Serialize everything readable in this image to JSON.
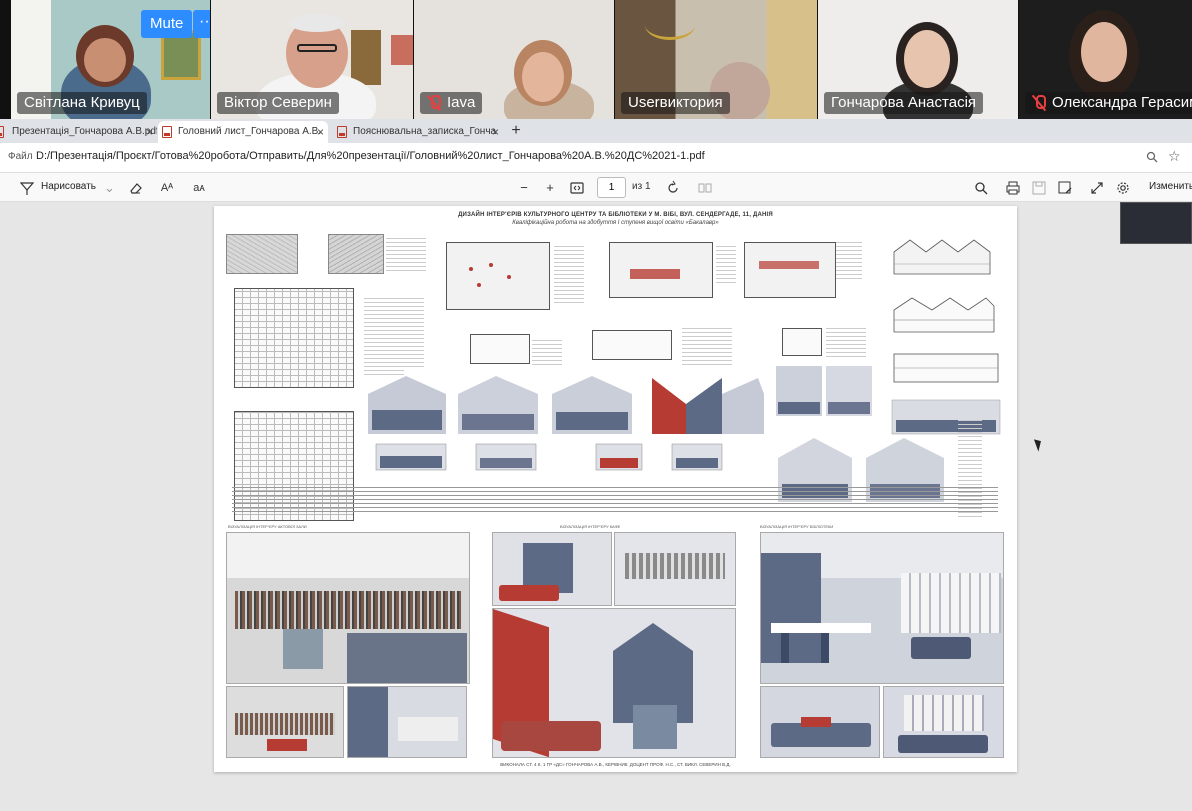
{
  "meeting": {
    "mute_label": "Mute",
    "more_label": "···",
    "participants": [
      {
        "name": "Світлана Кривуц",
        "muted": false
      },
      {
        "name": "Віктор Северин",
        "muted": false,
        "active_speaker": true
      },
      {
        "name": "Iava",
        "muted": true
      },
      {
        "name": "Userвиктория",
        "muted": false
      },
      {
        "name": "Гончарова Анастасія",
        "muted": false
      },
      {
        "name": "Олександра Герасим",
        "muted": true
      }
    ]
  },
  "browser": {
    "tabs": [
      {
        "label": "Презентація_Гончарова А.В.pdf",
        "active": false
      },
      {
        "label": "Головний лист_Гончарова А.В.",
        "active": true
      },
      {
        "label": "Пояснювальна_записка_Гонча",
        "active": false
      }
    ],
    "new_tab_label": "+",
    "close_label": "×",
    "file_label": "Файл",
    "url": "D:/Презентація/Проєкт/Готова%20робота/Отправить/Для%20презентації/Головний%20лист_Гончарова%20А.В.%20ДС%2021-1.pdf"
  },
  "pdf_toolbar": {
    "draw_label": "Нарисовать",
    "text_size_label": "Aᴬ",
    "read_label": "aᴀ",
    "zoom_out": "−",
    "zoom_in": "+",
    "page_current": "1",
    "page_total": "из 1",
    "edit_label": "Изменить"
  },
  "poster": {
    "title": "ДИЗАЙН ІНТЕР'ЄРІВ КУЛЬТУРНОГО ЦЕНТРУ ТА БІБЛІОТЕКИ У М. ВІБІ, ВУЛ. СЕНДЕРГАДЕ, 11, ДАНІЯ",
    "subtitle": "Кваліфікаційна робота на здобуття І ступеня вищої освіти «Бакалавр»",
    "footer": "ВИКОНАЛА СТ. 4 К. 1 ГР «ДС» ГОНЧАРОВА А.В., КЕРІВНИК: ДОЦЕНТ ПРОФ. Н.С., СТ. ВИКЛ. СЕВЕРИН В.Д.",
    "section_labels": [
      "ВІЗУАЛІЗАЦІЯ ІНТЕР'ЄРУ АКТОВОЇ ЗАЛИ",
      "ВІЗУАЛІЗАЦІЯ ІНТЕР'ЄРУ КАФЕ",
      "ВІЗУАЛІЗАЦІЯ ІНТЕР'ЄРУ БІБЛІОТЕКИ"
    ]
  },
  "colors": {
    "zoom_blue": "#2d8cff",
    "active_speaker": "#2ed573",
    "muted_red": "#e84040",
    "accent_red": "#b63b32",
    "slate": "#5d6a85"
  }
}
